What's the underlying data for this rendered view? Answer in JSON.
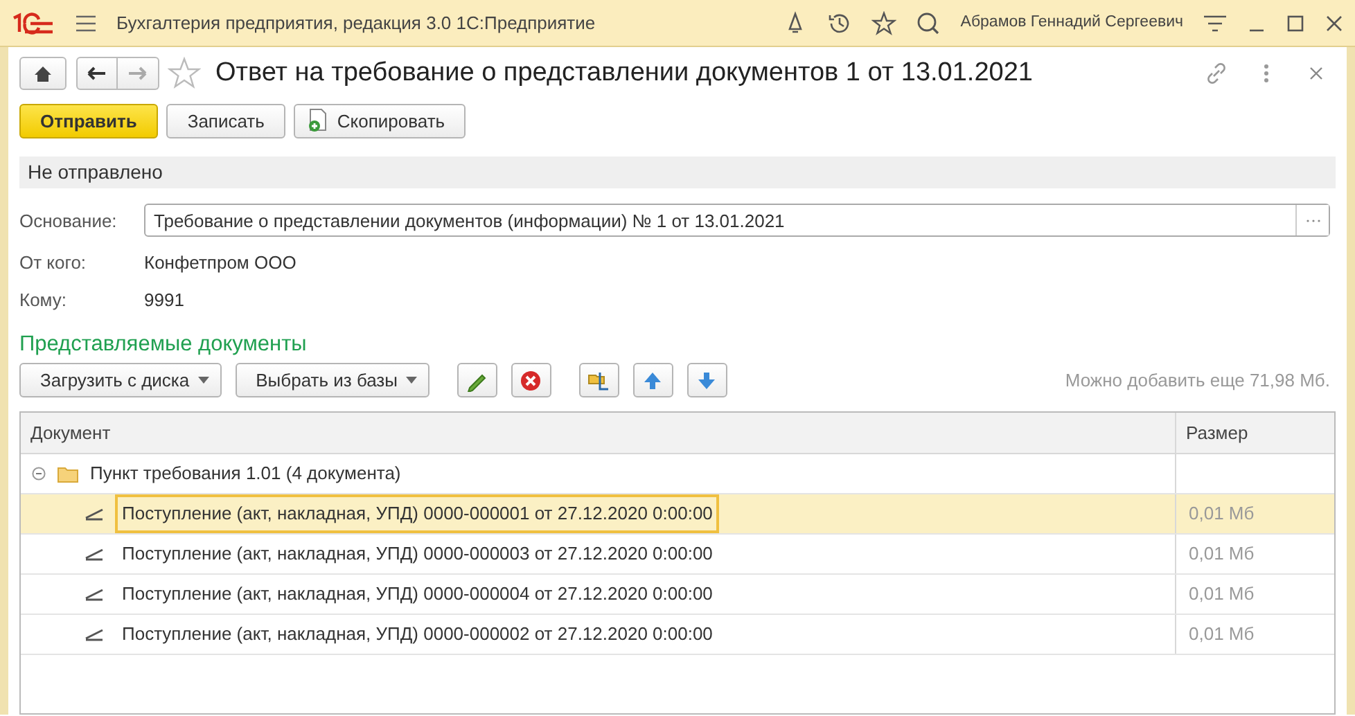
{
  "app_bar": {
    "title": "Бухгалтерия предприятия, редакция 3.0 1С:Предприятие",
    "user": "Абрамов Геннадий Сергеевич"
  },
  "form": {
    "title": "Ответ на требование о представлении документов 1 от 13.01.2021",
    "favorite": false
  },
  "buttons": [
    {
      "label": "Отправить",
      "kind": "primary"
    },
    {
      "label": "Записать",
      "kind": "plain"
    },
    {
      "label": "Скопировать",
      "kind": "copy"
    }
  ],
  "status": "Не отправлено",
  "fields": [
    {
      "label": "Основание:",
      "value": "Требование о представлении документов (информации) № 1 от 13.01.2021",
      "kind": "input"
    },
    {
      "label": "От кого:",
      "value": "Конфетпром ООО",
      "kind": "text"
    },
    {
      "label": "Кому:",
      "value": "9991",
      "kind": "text"
    }
  ],
  "section_title": "Представляемые документы",
  "toolbar": {
    "dropdowns": [
      "Загрузить с диска",
      "Выбрать из базы"
    ],
    "hint": "Можно добавить еще 71,98 Мб."
  },
  "table": {
    "columns": [
      "Документ",
      "Размер"
    ],
    "groups": [
      {
        "label": "Пункт требования 1.01 (4 документа)",
        "expanded": true,
        "children": [
          {
            "document": "Поступление (акт, накладная, УПД) 0000-000001 от 27.12.2020 0:00:00",
            "size": "0,01 Мб",
            "selected": true
          },
          {
            "document": "Поступление (акт, накладная, УПД) 0000-000003 от 27.12.2020 0:00:00",
            "size": "0,01 Мб",
            "selected": false
          },
          {
            "document": "Поступление (акт, накладная, УПД) 0000-000004 от 27.12.2020 0:00:00",
            "size": "0,01 Мб",
            "selected": false
          },
          {
            "document": "Поступление (акт, накладная, УПД) 0000-000002 от 27.12.2020 0:00:00",
            "size": "0,01 Мб",
            "selected": false
          }
        ]
      }
    ]
  }
}
